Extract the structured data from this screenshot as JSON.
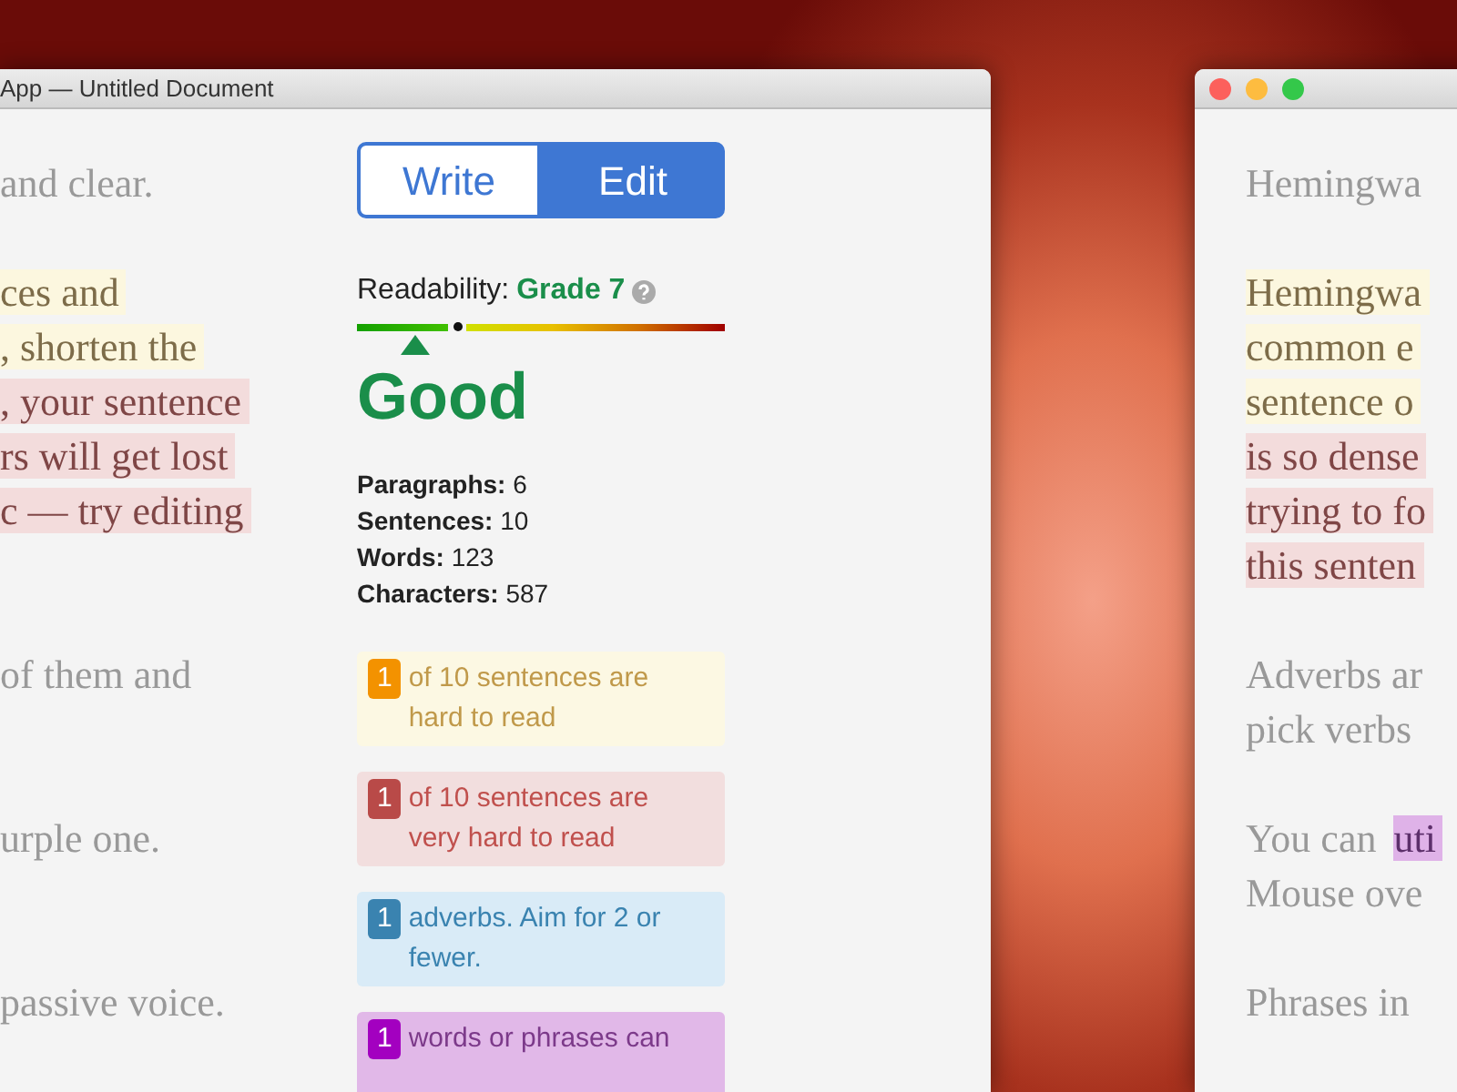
{
  "windows": [
    {
      "title": "App — Untitled Document",
      "paragraphs": [
        [
          [
            {
              "text": "and clear.",
              "kind": "plain"
            }
          ]
        ],
        [
          [
            {
              "text": "ces and",
              "kind": "hard"
            }
          ],
          [
            {
              "text": ", shorten the",
              "kind": "hard"
            }
          ],
          [
            {
              "text": ", your sentence",
              "kind": "very-hard"
            }
          ],
          [
            {
              "text": "rs will get lost",
              "kind": "very-hard"
            }
          ],
          [
            {
              "text": "c — try editing",
              "kind": "very-hard"
            }
          ]
        ],
        [
          [
            {
              "text": "of them and",
              "kind": "plain"
            }
          ]
        ],
        [
          [
            {
              "text": "urple one.",
              "kind": "plain"
            }
          ]
        ],
        [
          [
            {
              "text": "passive voice.",
              "kind": "plain"
            }
          ]
        ]
      ],
      "sidebar": {
        "modes": [
          {
            "label": "Write",
            "selected": false
          },
          {
            "label": "Edit",
            "selected": true
          }
        ],
        "readability_label": "Readability:",
        "grade": "Grade 7",
        "level": 0.16,
        "verdict": "Good",
        "stats": [
          {
            "label": "Paragraphs:",
            "value": "6"
          },
          {
            "label": "Sentences:",
            "value": "10"
          },
          {
            "label": "Words:",
            "value": "123"
          },
          {
            "label": "Characters:",
            "value": "587"
          }
        ],
        "hints": [
          {
            "kind": "hard",
            "count": "1",
            "before": "of 10 sentences are",
            "link": "hard to read"
          },
          {
            "kind": "very-hard",
            "count": "1",
            "before": "of 10 sentences are",
            "link": "very hard to read"
          },
          {
            "kind": "adverb",
            "count": "1",
            "link": "adverbs",
            "after": ". Aim for 2 or fewer."
          },
          {
            "kind": "simpler",
            "count": "1",
            "before": "words or phrases",
            "link": "can"
          }
        ]
      }
    },
    {
      "paragraphs": [
        [
          [
            {
              "text": "Hemingwa",
              "kind": "plain"
            }
          ]
        ],
        [
          [
            {
              "text": "Hemingwa",
              "kind": "hard"
            }
          ],
          [
            {
              "text": "common e",
              "kind": "hard"
            }
          ],
          [
            {
              "text": "sentence o",
              "kind": "hard"
            }
          ],
          [
            {
              "text": "is so dense",
              "kind": "very-hard"
            }
          ],
          [
            {
              "text": "trying to fo",
              "kind": "very-hard"
            }
          ],
          [
            {
              "text": "this senten",
              "kind": "very-hard"
            }
          ]
        ],
        [
          [
            {
              "text": "Adverbs ar",
              "kind": "plain"
            }
          ],
          [
            {
              "text": "pick verbs",
              "kind": "plain"
            }
          ]
        ],
        [
          [
            {
              "text": "You can ",
              "kind": "plain"
            },
            {
              "text": "uti",
              "kind": "simpler"
            }
          ],
          [
            {
              "text": "Mouse ove",
              "kind": "plain"
            }
          ]
        ],
        [
          [
            {
              "text": "Phrases in",
              "kind": "plain"
            }
          ]
        ]
      ]
    }
  ]
}
